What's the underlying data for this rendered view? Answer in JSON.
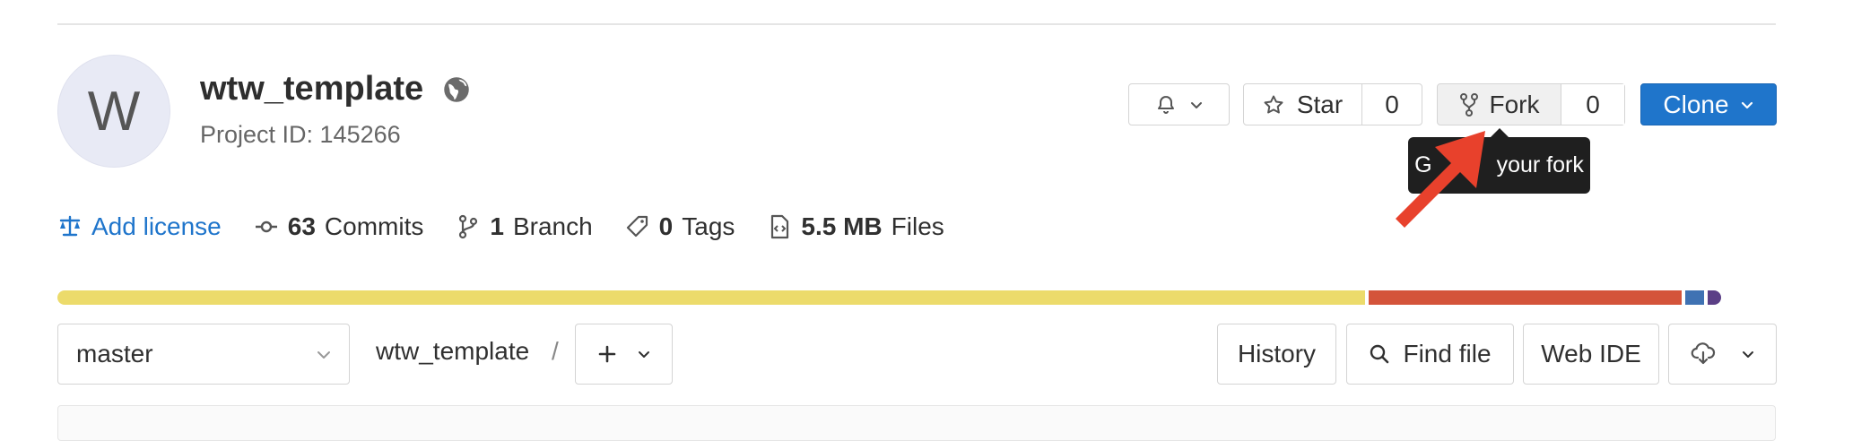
{
  "project": {
    "avatar_letter": "W",
    "name": "wtw_template",
    "visibility_icon": "globe-icon",
    "id_label": "Project ID: 145266"
  },
  "header_actions": {
    "notification_icon": "bell-icon",
    "star_label": "Star",
    "star_count": "0",
    "fork_label": "Fork",
    "fork_count": "0",
    "clone_label": "Clone"
  },
  "tooltip": {
    "text_left": "G",
    "text_right": "your fork"
  },
  "stats": {
    "license_label": "Add license",
    "commits_count": "63",
    "commits_label": "Commits",
    "branch_count": "1",
    "branch_label": "Branch",
    "tags_count": "0",
    "tags_label": "Tags",
    "files_size": "5.5 MB",
    "files_label": "Files"
  },
  "language_bar": {
    "segments": [
      {
        "color": "#ecdb6b",
        "fraction": 0.761
      },
      {
        "color": "#d4543a",
        "fraction": 0.182
      },
      {
        "color": "#3f72b3",
        "fraction": 0.011
      },
      {
        "color": "#5b3f86",
        "fraction": 0.008
      }
    ]
  },
  "repo_nav": {
    "branch": "master",
    "path_root": "wtw_template",
    "separator": "/",
    "add_icon": "plus-icon",
    "history_label": "History",
    "find_file_label": "Find file",
    "web_ide_label": "Web IDE",
    "download_icon": "cloud-download-icon"
  },
  "colors": {
    "accent": "#1f75cb",
    "annotation_arrow": "#e8412c"
  }
}
